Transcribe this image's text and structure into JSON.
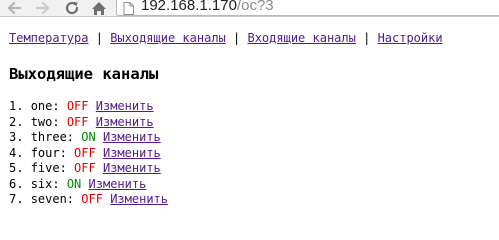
{
  "browser": {
    "url_host": "192.168.1.170",
    "url_path": "/oc?3"
  },
  "nav": {
    "items": [
      "Температура",
      "Выходящие каналы",
      "Входящие каналы",
      "Настройки"
    ],
    "separator": "|"
  },
  "page": {
    "title": "Выходящие каналы"
  },
  "channels": [
    {
      "index": "1.",
      "name": "one:",
      "state": "OFF",
      "action": "Изменить"
    },
    {
      "index": "2.",
      "name": "two:",
      "state": "OFF",
      "action": "Изменить"
    },
    {
      "index": "3.",
      "name": "three:",
      "state": "ON",
      "action": "Изменить"
    },
    {
      "index": "4.",
      "name": "four:",
      "state": "OFF",
      "action": "Изменить"
    },
    {
      "index": "5.",
      "name": "five:",
      "state": "OFF",
      "action": "Изменить"
    },
    {
      "index": "6.",
      "name": "six:",
      "state": "ON",
      "action": "Изменить"
    },
    {
      "index": "7.",
      "name": "seven:",
      "state": "OFF",
      "action": "Изменить"
    }
  ],
  "colors": {
    "off": "#e00000",
    "on": "#008a00",
    "link": "#551a8b"
  },
  "icons": [
    "back-arrow-icon",
    "forward-arrow-icon",
    "reload-icon",
    "home-icon",
    "page-icon"
  ]
}
